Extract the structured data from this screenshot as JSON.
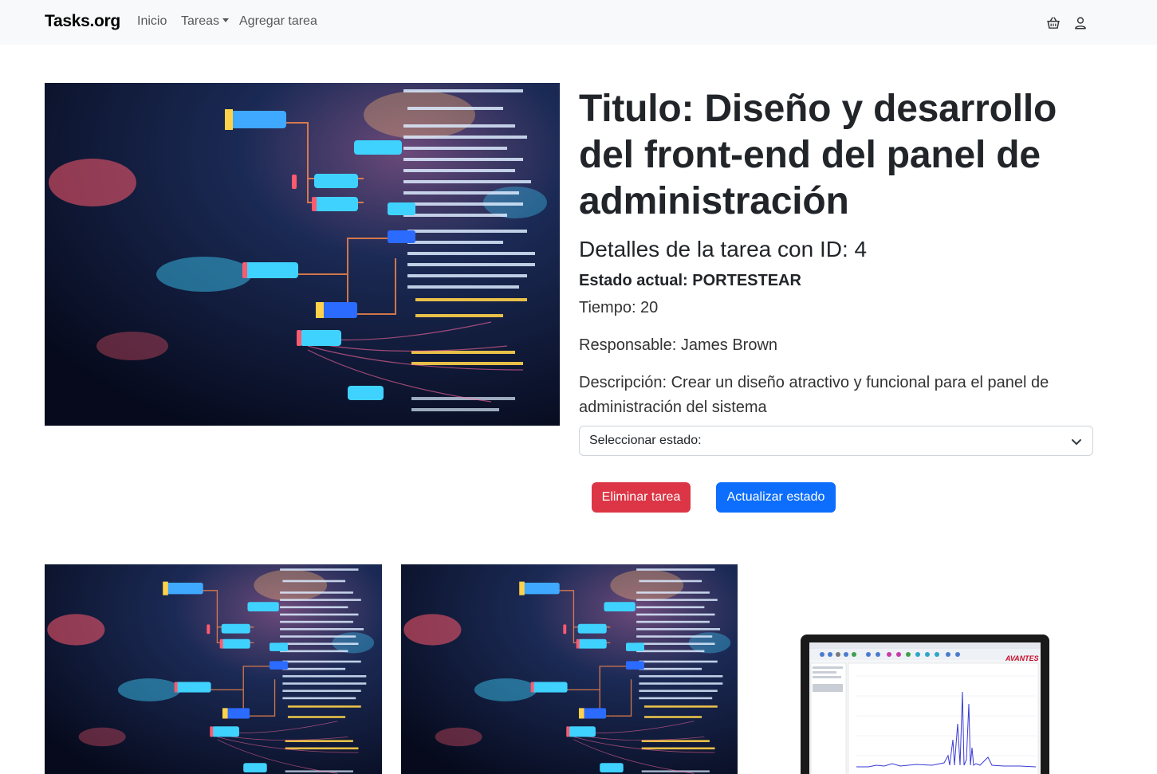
{
  "navbar": {
    "brand": "Tasks.org",
    "links": [
      {
        "label": "Inicio"
      },
      {
        "label": "Tareas"
      },
      {
        "label": "Agregar tarea"
      }
    ],
    "icons": [
      "basket-icon",
      "person-icon"
    ]
  },
  "task": {
    "title": "Titulo: Diseño y desarrollo del front-end del panel de administración",
    "subtitle": "Detalles de la tarea con ID: 4",
    "estado": "Estado actual: PORTESTEAR",
    "tiempo": "Tiempo: 20",
    "responsable": "Responsable: James Brown",
    "descripcion": "Descripción: Crear un diseño atractivo y funcional para el panel de administración del sistema"
  },
  "select": {
    "selected": "Seleccionar estado:"
  },
  "buttons": {
    "delete": "Eliminar tarea",
    "update": "Actualizar estado"
  },
  "images": {
    "hero": "code-network-image",
    "cards": [
      "code-network-image",
      "code-network-image",
      "laptop-spectrometer-image"
    ],
    "laptop_brand": "AVANTES"
  },
  "colors": {
    "danger": "#dc3545",
    "primary": "#0d6efd",
    "navbar_bg": "#f8f9fa"
  }
}
